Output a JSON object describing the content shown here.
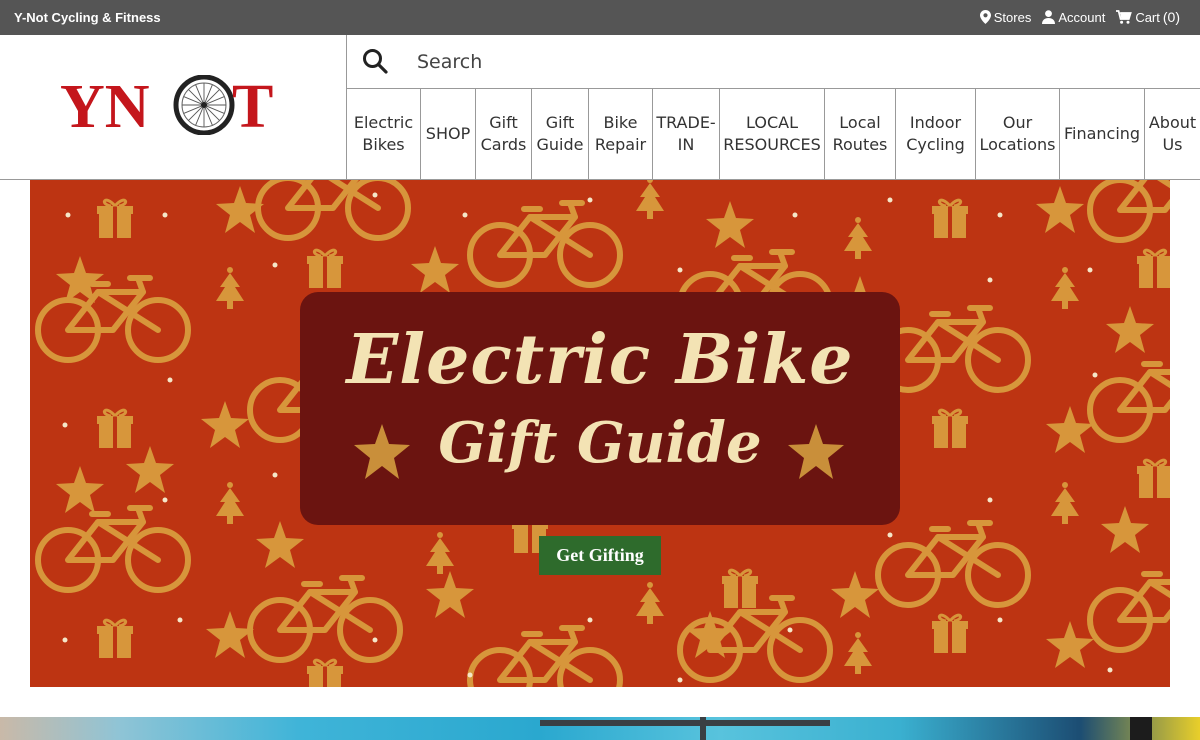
{
  "topbar": {
    "brand": "Y-Not Cycling & Fitness",
    "stores_label": "Stores",
    "account_label": "Account",
    "cart_label": "Cart",
    "cart_count": "(0)"
  },
  "header": {
    "logo_text": "YNOT",
    "search_placeholder": "Search"
  },
  "nav": {
    "items": [
      {
        "line1": "Electric",
        "line2": "Bikes"
      },
      {
        "line1": "SHOP",
        "line2": ""
      },
      {
        "line1": "Gift",
        "line2": "Cards"
      },
      {
        "line1": "Gift",
        "line2": "Guide"
      },
      {
        "line1": "Bike",
        "line2": "Repair"
      },
      {
        "line1": "TRADE-",
        "line2": "IN"
      },
      {
        "line1": "LOCAL",
        "line2": "RESOURCES"
      },
      {
        "line1": "Local",
        "line2": "Routes"
      },
      {
        "line1": "Indoor",
        "line2": "Cycling"
      },
      {
        "line1": "Our",
        "line2": "Locations"
      },
      {
        "line1": "Financing",
        "line2": ""
      },
      {
        "line1": "About",
        "line2": "Us"
      }
    ]
  },
  "hero": {
    "title_line1": "Electric Bike",
    "title_line2": "Gift Guide",
    "cta_label": "Get Gifting"
  },
  "colors": {
    "topbar_bg": "#555555",
    "logo_red": "#c4161c",
    "hero_bg": "#bd3412",
    "pattern_gold": "#d7963b",
    "panel_bg": "#6b1410",
    "title_cream": "#f3e3b4",
    "cta_green": "#2e6b2c"
  }
}
